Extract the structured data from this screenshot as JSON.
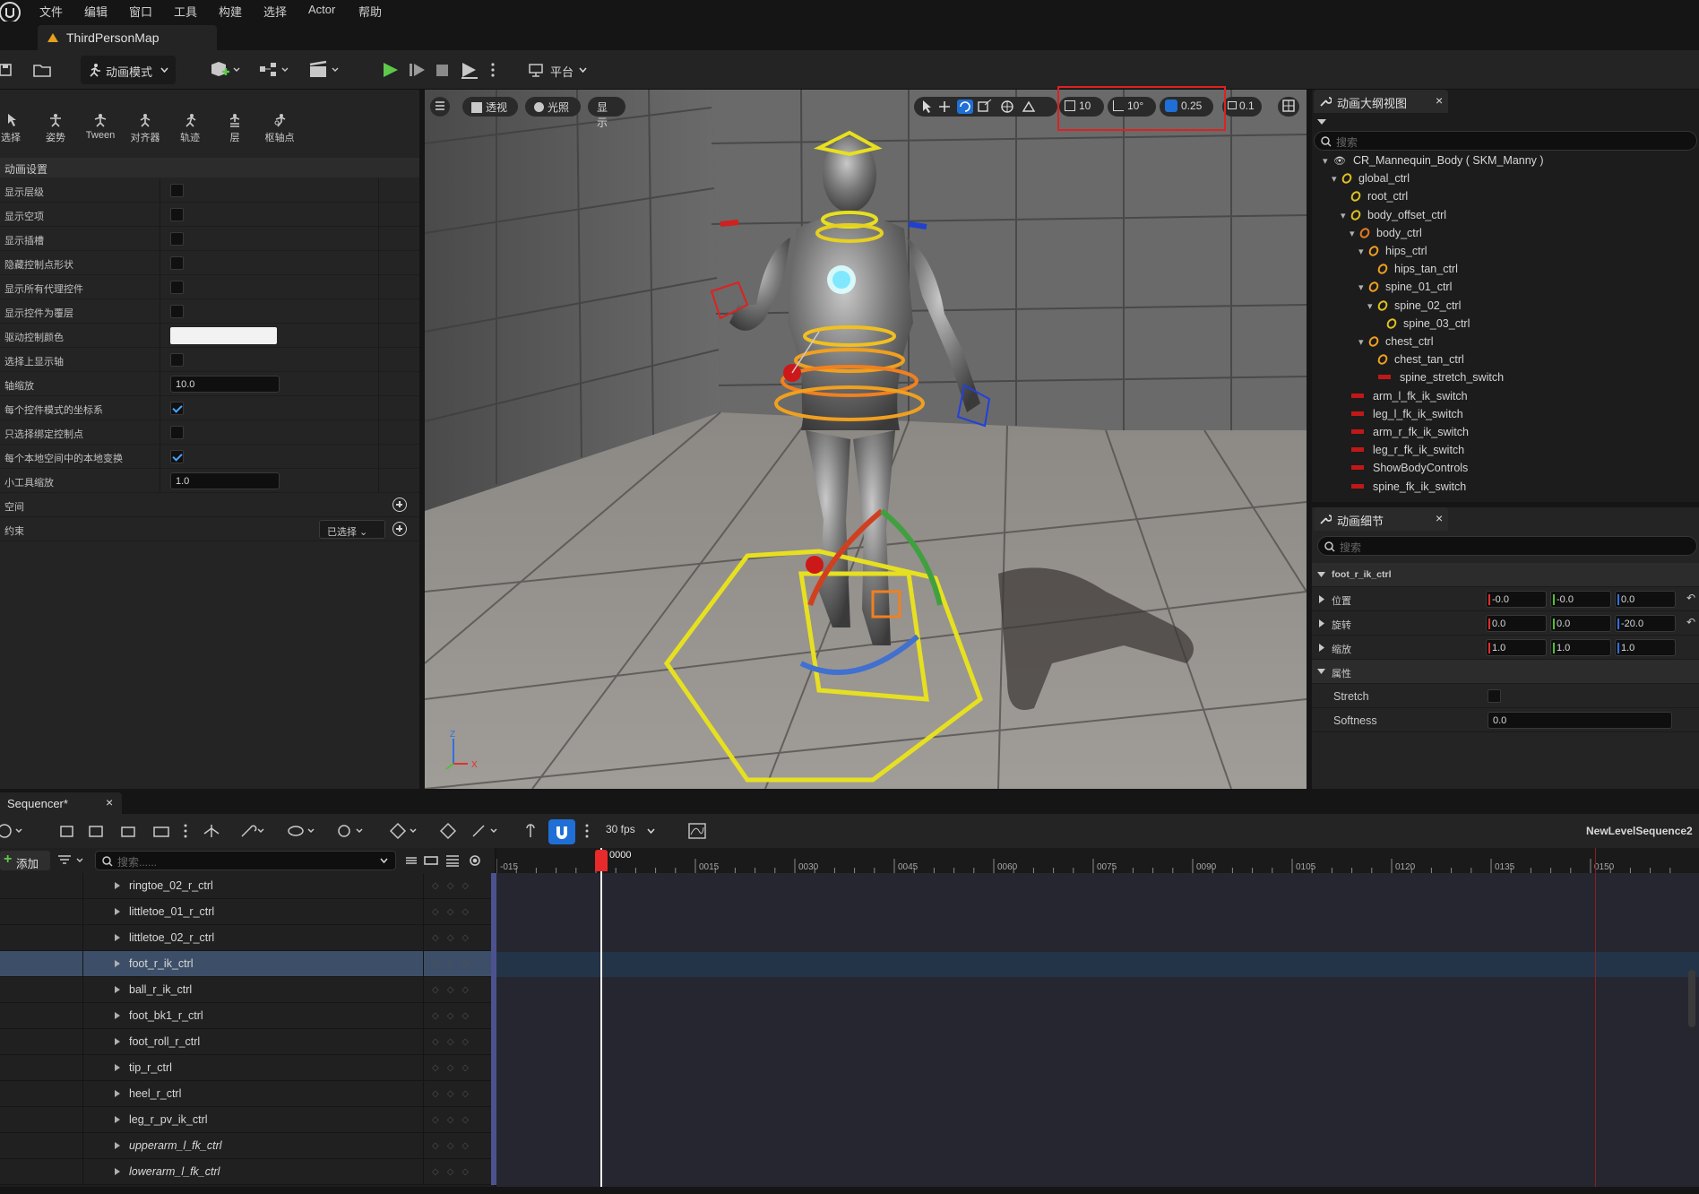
{
  "menu": [
    "文件",
    "编辑",
    "窗口",
    "工具",
    "构建",
    "选择",
    "Actor",
    "帮助"
  ],
  "map_tab": "ThirdPersonMap",
  "toolbar": {
    "mode_label": "动画模式",
    "platform_label": "平台"
  },
  "tools": [
    "选择",
    "姿势",
    "Tween",
    "对齐器",
    "轨迹",
    "层",
    "枢轴点"
  ],
  "anim_settings": {
    "header": "动画设置",
    "rows": [
      {
        "label": "显示层级",
        "type": "check",
        "checked": false
      },
      {
        "label": "显示空项",
        "type": "check",
        "checked": false
      },
      {
        "label": "显示插槽",
        "type": "check",
        "checked": false
      },
      {
        "label": "隐藏控制点形状",
        "type": "check",
        "checked": false
      },
      {
        "label": "显示所有代理控件",
        "type": "check",
        "checked": false
      },
      {
        "label": "显示控件为覆层",
        "type": "check",
        "checked": false
      },
      {
        "label": "驱动控制颜色",
        "type": "color",
        "color": "#f2f2f2"
      },
      {
        "label": "选择上显示轴",
        "type": "check",
        "checked": false
      },
      {
        "label": "轴缩放",
        "type": "number",
        "value": "10.0"
      },
      {
        "label": "每个控件模式的坐标系",
        "type": "check",
        "checked": true
      },
      {
        "label": "只选择绑定控制点",
        "type": "check",
        "checked": false
      },
      {
        "label": "每个本地空间中的本地变换",
        "type": "check",
        "checked": true
      },
      {
        "label": "小工具缩放",
        "type": "number",
        "value": "1.0"
      },
      {
        "label": "空间",
        "type": "plus"
      },
      {
        "label": "约束",
        "type": "select",
        "value": "已选择"
      }
    ]
  },
  "viewport": {
    "perspective": "透视",
    "lighting": "光照",
    "show": "显示",
    "grid_snap": "10",
    "rot_snap": "10°",
    "scale_snap": "0.25",
    "cam_speed": "0.1"
  },
  "outliner": {
    "tab": "动画大纲视图",
    "search_placeholder": "搜索",
    "items": [
      {
        "label": "CR_Mannequin_Body ( SKM_Manny )",
        "indent": 0,
        "kind": "root"
      },
      {
        "label": "global_ctrl",
        "indent": 1,
        "kind": "ctrl"
      },
      {
        "label": "root_ctrl",
        "indent": 2,
        "kind": "ctrl"
      },
      {
        "label": "body_offset_ctrl",
        "indent": 2,
        "kind": "ctrl"
      },
      {
        "label": "body_ctrl",
        "indent": 3,
        "kind": "dark"
      },
      {
        "label": "hips_ctrl",
        "indent": 4,
        "kind": "orange"
      },
      {
        "label": "hips_tan_ctrl",
        "indent": 5,
        "kind": "orange"
      },
      {
        "label": "spine_01_ctrl",
        "indent": 4,
        "kind": "orange"
      },
      {
        "label": "spine_02_ctrl",
        "indent": 5,
        "kind": "ctrl"
      },
      {
        "label": "spine_03_ctrl",
        "indent": 6,
        "kind": "ctrl"
      },
      {
        "label": "chest_ctrl",
        "indent": 4,
        "kind": "orange"
      },
      {
        "label": "chest_tan_ctrl",
        "indent": 5,
        "kind": "orange"
      },
      {
        "label": "spine_stretch_switch",
        "indent": 5,
        "kind": "switch"
      },
      {
        "label": "arm_l_fk_ik_switch",
        "indent": 2,
        "kind": "switch"
      },
      {
        "label": "leg_l_fk_ik_switch",
        "indent": 2,
        "kind": "switch"
      },
      {
        "label": "arm_r_fk_ik_switch",
        "indent": 2,
        "kind": "switch"
      },
      {
        "label": "leg_r_fk_ik_switch",
        "indent": 2,
        "kind": "switch"
      },
      {
        "label": "ShowBodyControls",
        "indent": 2,
        "kind": "switch"
      },
      {
        "label": "spine_fk_ik_switch",
        "indent": 2,
        "kind": "switch"
      }
    ]
  },
  "details": {
    "tab": "动画细节",
    "search_placeholder": "搜索",
    "section": "foot_r_ik_ctrl",
    "location": {
      "label": "位置",
      "x": "-0.0",
      "y": "-0.0",
      "z": "0.0"
    },
    "rotation": {
      "label": "旋转",
      "x": "0.0",
      "y": "0.0",
      "z": "-20.0"
    },
    "scale": {
      "label": "缩放",
      "x": "1.0",
      "y": "1.0",
      "z": "1.0"
    },
    "attributes": "属性",
    "stretch": {
      "label": "Stretch",
      "checked": false
    },
    "softness": {
      "label": "Softness",
      "value": "0.0"
    }
  },
  "sequencer": {
    "tab": "Sequencer*",
    "fps": "30 fps",
    "sequence_name": "NewLevelSequence2",
    "add_label": "添加",
    "search_placeholder": "搜索......",
    "playhead": "0000",
    "ticks": [
      "-015",
      "0015",
      "0030",
      "0045",
      "0060",
      "0075",
      "0090",
      "0105",
      "0120",
      "0135",
      "0150"
    ],
    "tracks": [
      {
        "name": "ringtoe_02_r_ctrl",
        "italic": false,
        "selected": false
      },
      {
        "name": "littletoe_01_r_ctrl",
        "italic": false,
        "selected": false
      },
      {
        "name": "littletoe_02_r_ctrl",
        "italic": false,
        "selected": false
      },
      {
        "name": "foot_r_ik_ctrl",
        "italic": false,
        "selected": true
      },
      {
        "name": "ball_r_ik_ctrl",
        "italic": false,
        "selected": false
      },
      {
        "name": "foot_bk1_r_ctrl",
        "italic": false,
        "selected": false
      },
      {
        "name": "foot_roll_r_ctrl",
        "italic": false,
        "selected": false
      },
      {
        "name": "tip_r_ctrl",
        "italic": false,
        "selected": false
      },
      {
        "name": "heel_r_ctrl",
        "italic": false,
        "selected": false
      },
      {
        "name": "leg_r_pv_ik_ctrl",
        "italic": false,
        "selected": false
      },
      {
        "name": "upperarm_l_fk_ctrl",
        "italic": true,
        "selected": false
      },
      {
        "name": "lowerarm_l_fk_ctrl",
        "italic": true,
        "selected": false
      }
    ]
  }
}
